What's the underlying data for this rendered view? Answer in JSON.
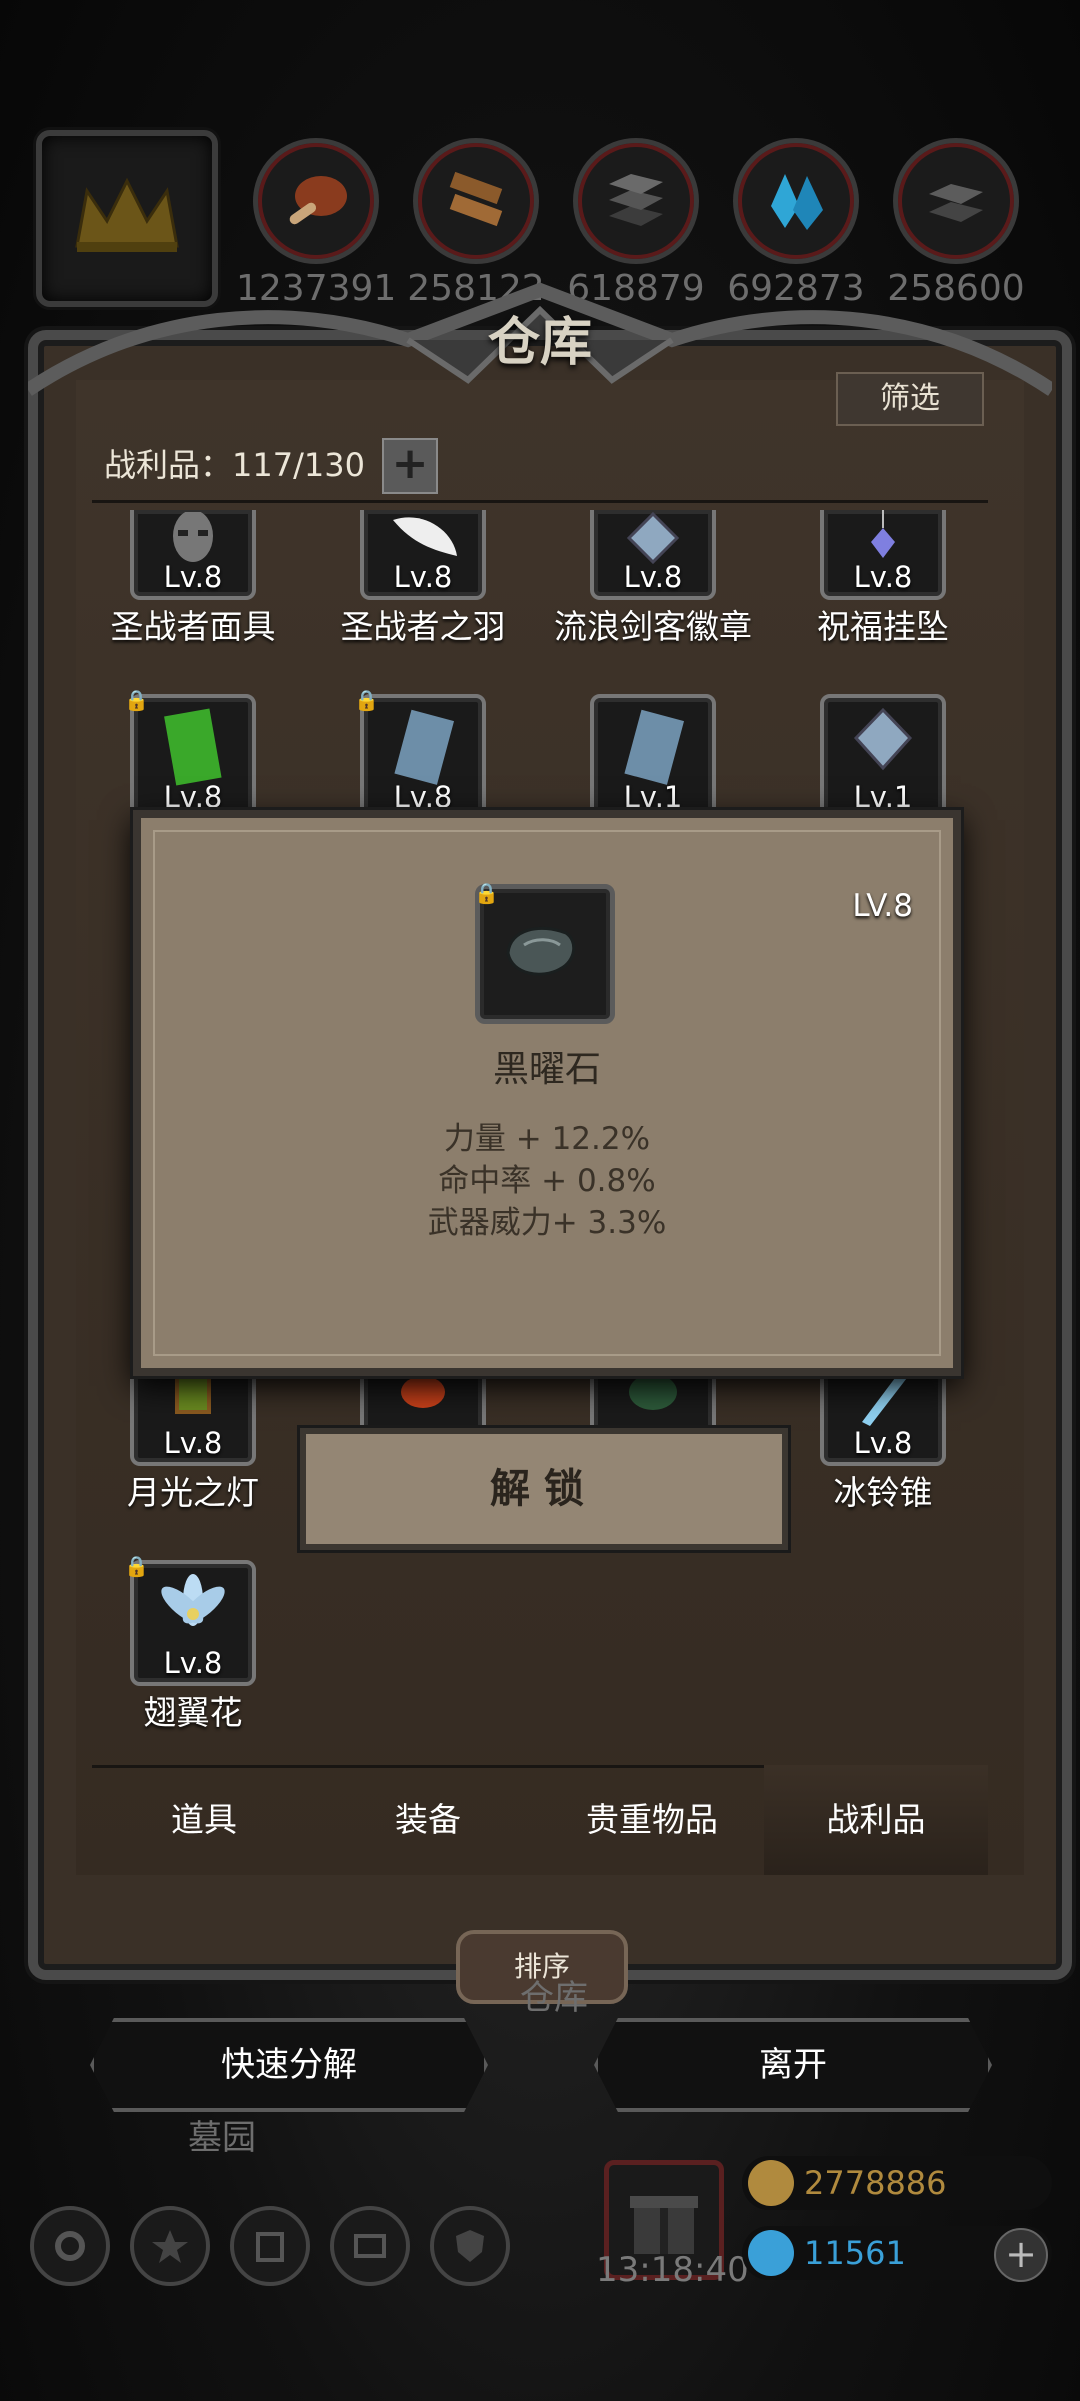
{
  "resources": {
    "crown_icon": "crown-icon",
    "items": [
      {
        "icon": "meat-icon",
        "value": "1237391",
        "color": "#b4522a"
      },
      {
        "icon": "wood-icon",
        "value": "258122",
        "color": "#a8703a"
      },
      {
        "icon": "iron-icon",
        "value": "618879",
        "color": "#5a5a5a"
      },
      {
        "icon": "crystal-icon",
        "value": "692873",
        "color": "#2fa6d6"
      },
      {
        "icon": "steel-icon",
        "value": "258600",
        "color": "#555555"
      }
    ]
  },
  "panel": {
    "title": "仓库",
    "filter_label": "筛选",
    "loot_count": "战利品：117/130",
    "plus": "+"
  },
  "items": [
    {
      "name": "圣战者面具",
      "level": "Lv.8",
      "locked": false,
      "icon": "mask-icon"
    },
    {
      "name": "圣战者之羽",
      "level": "Lv.8",
      "locked": false,
      "icon": "feather-icon"
    },
    {
      "name": "流浪剑客徽章",
      "level": "Lv.8",
      "locked": false,
      "icon": "badge-icon"
    },
    {
      "name": "祝福挂坠",
      "level": "Lv.8",
      "locked": false,
      "icon": "pendant-icon"
    },
    {
      "name": "",
      "level": "Lv.8",
      "locked": true,
      "icon": "green-book-icon"
    },
    {
      "name": "",
      "level": "Lv.8",
      "locked": true,
      "icon": "blue-book-icon"
    },
    {
      "name": "",
      "level": "Lv.1",
      "locked": false,
      "icon": "blue-book-icon"
    },
    {
      "name": "",
      "level": "Lv.1",
      "locked": false,
      "icon": "badge-icon"
    },
    {
      "name": "月光之灯",
      "level": "Lv.8",
      "locked": false,
      "icon": "lantern-icon"
    },
    {
      "name": "",
      "level": "",
      "locked": false,
      "icon": "fire-icon"
    },
    {
      "name": "",
      "level": "",
      "locked": false,
      "icon": "green-orb-icon"
    },
    {
      "name": "冰铃锥",
      "level": "Lv.8",
      "locked": false,
      "icon": "ice-spike-icon"
    },
    {
      "name": "翅翼花",
      "level": "Lv.8",
      "locked": true,
      "icon": "blue-flower-icon"
    }
  ],
  "popup": {
    "level": "LV.8",
    "name": "黑曜石",
    "icon": "obsidian-icon",
    "stats": [
      "力量 + 12.2%",
      "命中率 + 0.8%",
      "武器威力+ 3.3%"
    ],
    "unlock_label": "解锁"
  },
  "tabs": [
    {
      "label": "道具",
      "active": false
    },
    {
      "label": "装备",
      "active": false
    },
    {
      "label": "贵重物品",
      "active": false
    },
    {
      "label": "战利品",
      "active": true
    }
  ],
  "sort_label": "排序",
  "quick_decompose_label": "快速分解",
  "leave_label": "离开",
  "under_labels": {
    "left": "墓园",
    "mid": "仓库"
  },
  "hud": {
    "timer": "13:18:40",
    "gold": "2778886",
    "gems": "11561",
    "gold_color": "#b08a3e",
    "gem_color": "#3aa0d8"
  }
}
